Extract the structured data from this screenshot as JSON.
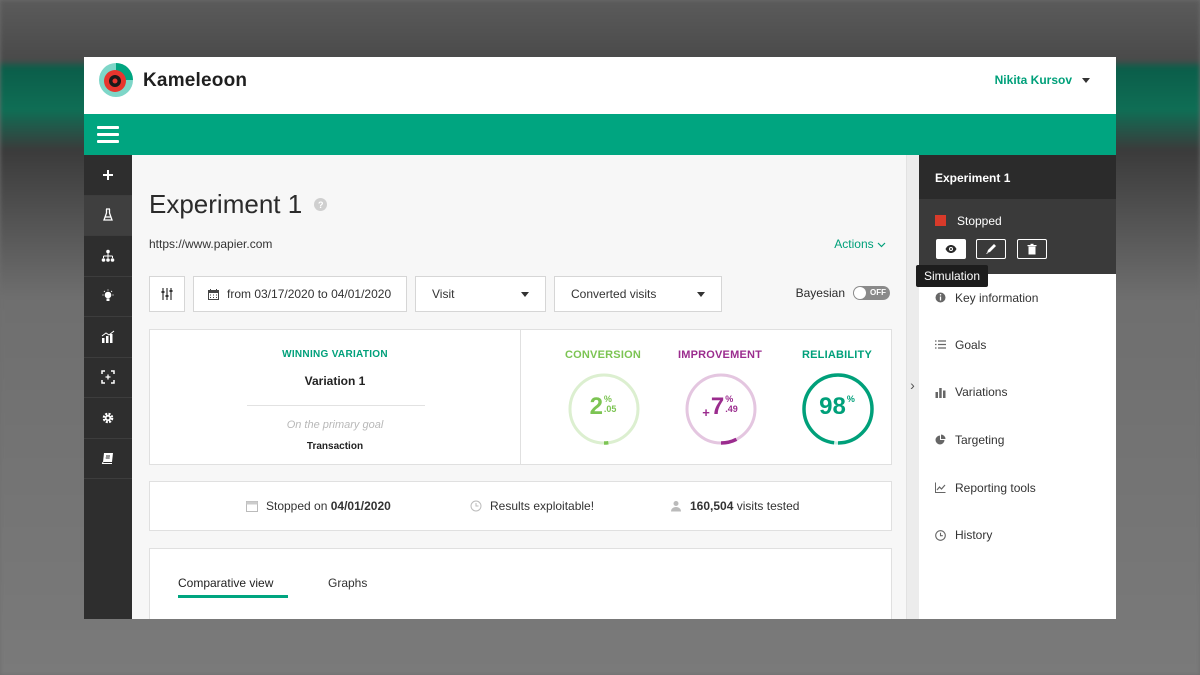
{
  "app": {
    "brand": "Kameleoon",
    "user_name": "Nikita Kursov"
  },
  "experiment": {
    "title": "Experiment 1",
    "url": "https://www.papier.com",
    "actions_label": "Actions"
  },
  "filters": {
    "date_range": "from 03/17/2020 to 04/01/2020",
    "unit_select": "Visit",
    "metric_select": "Converted visits",
    "bayesian_label": "Bayesian",
    "bayesian_toggle": "OFF"
  },
  "summary": {
    "winning_label": "WINNING VARIATION",
    "winning_name": "Variation 1",
    "goal_label": "On the primary goal",
    "goal_name": "Transaction",
    "metrics": [
      {
        "label": "CONVERSION",
        "prefix": "",
        "value": "2",
        "unit": "%",
        "decimal": ".05",
        "percent": 2.05,
        "color": "#7cc453",
        "track": "#dcefd0"
      },
      {
        "label": "IMPROVEMENT",
        "prefix": "+",
        "value": "7",
        "unit": "%",
        "decimal": ".49",
        "percent": 7.49,
        "color": "#9b2c8e",
        "track": "#e4c6e0"
      },
      {
        "label": "RELIABILITY",
        "prefix": "",
        "value": "98",
        "unit": "%",
        "decimal": "",
        "percent": 98,
        "color": "#00a07a",
        "track": "#cdeee4"
      }
    ]
  },
  "status": {
    "stopped_prefix": "Stopped on",
    "stopped_date": "04/01/2020",
    "results": "Results exploitable!",
    "visits_count": "160,504",
    "visits_suffix": "visits tested"
  },
  "tabs": [
    {
      "label": "Comparative view"
    },
    {
      "label": "Graphs"
    }
  ],
  "right_panel": {
    "title": "Experiment 1",
    "status": "Stopped",
    "status_color": "#d83a2a",
    "tooltip": "Simulation",
    "menu": [
      {
        "label": "Key information",
        "icon": "info-icon"
      },
      {
        "label": "Goals",
        "icon": "list-icon"
      },
      {
        "label": "Variations",
        "icon": "bar-chart-icon"
      },
      {
        "label": "Targeting",
        "icon": "pie-chart-icon"
      },
      {
        "label": "Reporting tools",
        "icon": "line-chart-icon"
      },
      {
        "label": "History",
        "icon": "clock-icon"
      }
    ]
  },
  "colors": {
    "accent": "#00a580",
    "sidebar": "#2e2e2e"
  }
}
